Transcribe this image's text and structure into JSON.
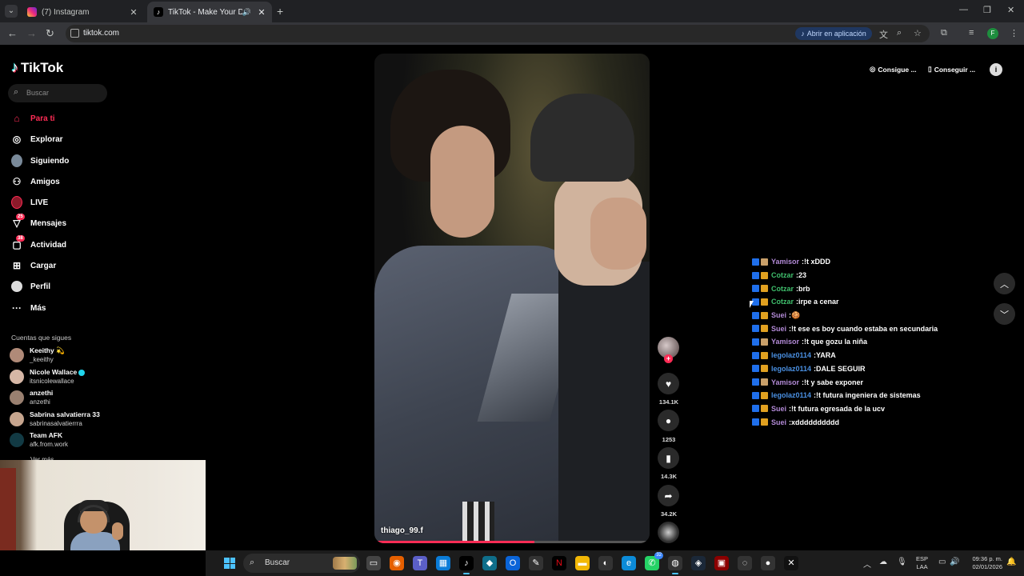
{
  "browser": {
    "tabs": [
      {
        "title": "(7) Instagram"
      },
      {
        "title": "TikTok - Make Your Day"
      }
    ],
    "url": "tiktok.com",
    "open_app_label": "Abrir en aplicación"
  },
  "app": {
    "logo_text": "TikTok",
    "search_placeholder": "Buscar",
    "nav": [
      {
        "label": "Para ti",
        "icon": "home-icon",
        "active": true
      },
      {
        "label": "Explorar",
        "icon": "compass-icon"
      },
      {
        "label": "Siguiendo",
        "icon": "following-avatar-icon"
      },
      {
        "label": "Amigos",
        "icon": "friends-icon"
      },
      {
        "label": "LIVE",
        "icon": "live-icon"
      },
      {
        "label": "Mensajes",
        "icon": "messages-icon",
        "badge": "25"
      },
      {
        "label": "Actividad",
        "icon": "activity-icon",
        "badge": "38"
      },
      {
        "label": "Cargar",
        "icon": "upload-icon"
      },
      {
        "label": "Perfil",
        "icon": "profile-icon"
      },
      {
        "label": "Más",
        "icon": "more-icon"
      }
    ],
    "following_title": "Cuentas que sigues",
    "following": [
      {
        "name": "Keeithy 💫",
        "username": "_keeithy"
      },
      {
        "name": "Nicole Wallace",
        "username": "itsnicolewallace",
        "verified": true
      },
      {
        "name": "anzethi",
        "username": "anzethi"
      },
      {
        "name": "Sabrina salvatierra 33",
        "username": "sabrinasalvatierrra"
      },
      {
        "name": "Team AFK",
        "username": "afk.from.work"
      }
    ],
    "see_more": "Ver más",
    "top_buttons": {
      "coins": "Consigue ...",
      "app": "Conseguir ..."
    }
  },
  "video": {
    "username": "thiago_99.f",
    "progress": 0.58,
    "likes": "134.1K",
    "comments": "1253",
    "saves": "14.3K",
    "shares": "34.2K"
  },
  "chat": [
    {
      "user": "Yamisor",
      "message": "!t xDDD",
      "color": "#b28ad6"
    },
    {
      "user": "Cotzar",
      "message": "23",
      "color": "#3fbf6c"
    },
    {
      "user": "Cotzar",
      "message": "brb",
      "color": "#3fbf6c"
    },
    {
      "user": "Cotzar",
      "message": "irpe a cenar",
      "color": "#3fbf6c"
    },
    {
      "user": "Suei",
      "message": "🍪",
      "color": "#b28ad6"
    },
    {
      "user": "Suei",
      "message": "!t ese es boy cuando estaba en secundaria",
      "color": "#b28ad6"
    },
    {
      "user": "Yamisor",
      "message": "!t que gozu la niña",
      "color": "#b28ad6"
    },
    {
      "user": "legolaz0114",
      "message": "YARA",
      "color": "#4a90e2"
    },
    {
      "user": "legolaz0114",
      "message": "DALE SEGUIR",
      "color": "#4a90e2"
    },
    {
      "user": "Yamisor",
      "message": "!t y sabe exponer",
      "color": "#b28ad6"
    },
    {
      "user": "legolaz0114",
      "message": "!t futura ingeniera de sistemas",
      "color": "#4a90e2"
    },
    {
      "user": "Suei",
      "message": "!t futura egresada de la ucv",
      "color": "#b28ad6"
    },
    {
      "user": "Suei",
      "message": "xdddddddddd",
      "color": "#b28ad6"
    }
  ],
  "taskbar": {
    "search_label": "Buscar",
    "whatsapp_count": "32",
    "lang_line1": "ESP",
    "lang_line2": "LAA",
    "time": "09:36 p. m.",
    "date": "02/01/2026"
  }
}
